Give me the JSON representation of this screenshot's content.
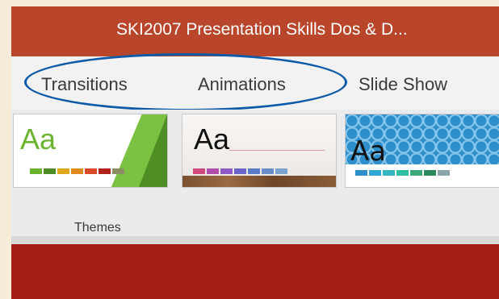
{
  "window": {
    "title": "SKI2007 Presentation Skills Dos & D..."
  },
  "ribbon": {
    "tabs": [
      {
        "label": "Transitions"
      },
      {
        "label": "Animations"
      },
      {
        "label": "Slide Show"
      }
    ],
    "highlight_color": "#0c5aa8"
  },
  "themes": {
    "group_label": "Themes",
    "items": [
      {
        "sample": "Aa",
        "swatches": [
          "#6ab42d",
          "#4f8e25",
          "#e0a81c",
          "#e08a1c",
          "#d84a2a",
          "#b0241a",
          "#8f8f66"
        ]
      },
      {
        "sample": "Aa",
        "swatches": [
          "#d1487e",
          "#b14dab",
          "#8d59c6",
          "#6b65c9",
          "#5a7bc8",
          "#6a8ec9",
          "#7aa3d0"
        ]
      },
      {
        "sample": "Aa",
        "swatches": [
          "#2d8fcb",
          "#2fa6d4",
          "#36b6c0",
          "#2ec0a0",
          "#3aaa7d",
          "#2b8a5a",
          "#8aa6a8"
        ]
      }
    ]
  },
  "colors": {
    "titlebar": "#b9462a",
    "slide_background": "#a51e16",
    "page_background": "#f6ecd9"
  }
}
